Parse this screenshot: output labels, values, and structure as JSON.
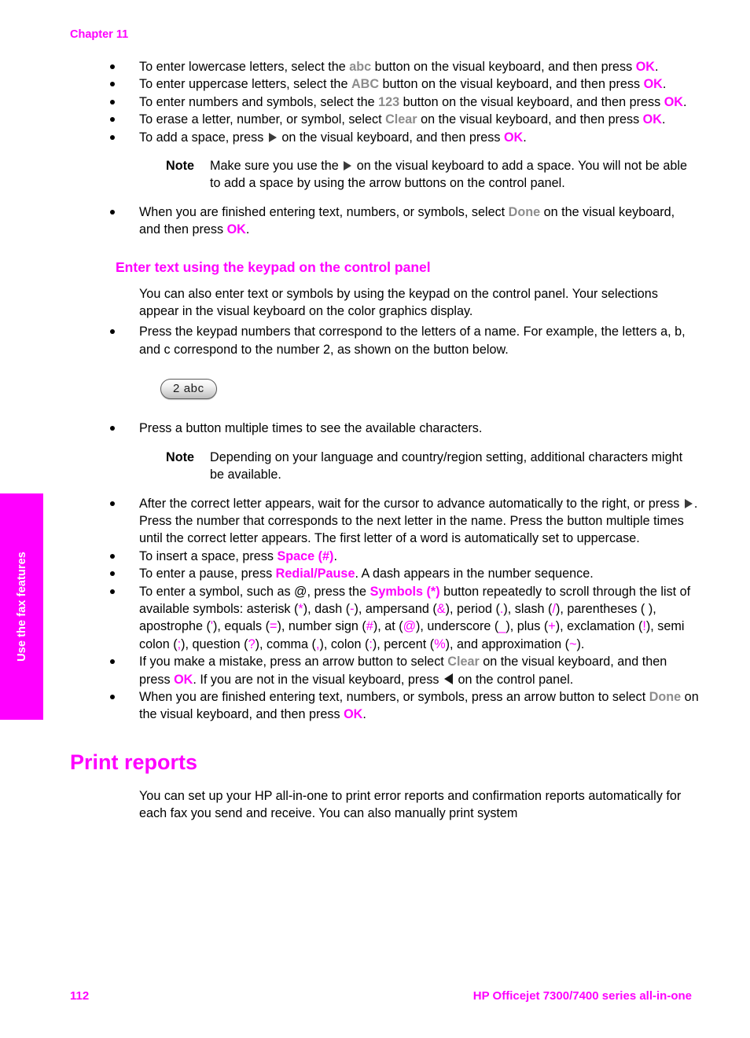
{
  "page": {
    "chapter_label": "Chapter 11",
    "footer_page_number": "112",
    "footer_title": "HP Officejet 7300/7400 series all-in-one",
    "side_tab_label": "Use the fax features",
    "accent_color": "#ff00ff",
    "gray_emphasis_color": "#8c8c8c",
    "text_color": "#000000"
  },
  "visual_keyboard_bullets": {
    "b1": {
      "t1": "To enter lowercase letters, select the ",
      "key": "abc",
      "t2": " button on the visual keyboard, and then press ",
      "ok": "OK",
      "t3": "."
    },
    "b2": {
      "t1": "To enter uppercase letters, select the ",
      "key": "ABC",
      "t2": " button on the visual keyboard, and then press ",
      "ok": "OK",
      "t3": "."
    },
    "b3": {
      "t1": "To enter numbers and symbols, select the ",
      "key": "123",
      "t2": " button on the visual keyboard, and then press ",
      "ok": "OK",
      "t3": "."
    },
    "b4": {
      "t1": "To erase a letter, number, or symbol, select ",
      "key": "Clear",
      "t2": " on the visual keyboard, and then press ",
      "ok": "OK",
      "t3": "."
    },
    "b5": {
      "t1": "To add a space, press ",
      "t2": " on the visual keyboard, and then press ",
      "ok": "OK",
      "t3": "."
    },
    "note1": {
      "label": "Note",
      "t1": "Make sure you use the ",
      "t2": " on the visual keyboard to add a space. You will not be able to add a space by using the arrow buttons on the control panel."
    },
    "b6": {
      "t1": "When you are finished entering text, numbers, or symbols, select ",
      "key": "Done",
      "t2": " on the visual keyboard, and then press ",
      "ok": "OK",
      "t3": "."
    }
  },
  "keypad_section": {
    "heading": "Enter text using the keypad on the control panel",
    "intro": "You can also enter text or symbols by using the keypad on the control panel. Your selections appear in the visual keyboard on the color graphics display.",
    "b1": "Press the keypad numbers that correspond to the letters of a name. For example, the letters a, b, and c correspond to the number 2, as shown on the button below.",
    "keypad_button_label": "2 abc",
    "b2": "Press a button multiple times to see the available characters.",
    "note2": {
      "label": "Note",
      "text": "Depending on your language and country/region setting, additional characters might be available."
    },
    "b3": {
      "t1": "After the correct letter appears, wait for the cursor to advance automatically to the right, or press ",
      "t2": ". Press the number that corresponds to the next letter in the name. Press the button multiple times until the correct letter appears. The first letter of a word is automatically set to uppercase."
    },
    "b4": {
      "t1": "To insert a space, press ",
      "key": "Space (#)",
      "t2": "."
    },
    "b5": {
      "t1": "To enter a pause, press ",
      "key": "Redial/Pause",
      "t2": ". A dash appears in the number sequence."
    },
    "b6": {
      "t1": "To enter a symbol, such as @, press the ",
      "key": "Symbols (*)",
      "t2": " button repeatedly to scroll through the list of available symbols: asterisk (",
      "s1": "*",
      "t3": "), dash (",
      "s2": "-",
      "t4": "), ampersand (",
      "s3": "&",
      "t5": "), period (",
      "s4": ".",
      "t6": "), slash (",
      "s5": "/",
      "t7": "), parentheses (",
      "s6": " ",
      "t8": "), apostrophe (",
      "s7": "'",
      "t9": "), equals (",
      "s8": "=",
      "t10": "), number sign (",
      "s9": "#",
      "t11": "), at (",
      "s10": "@",
      "t12": "), underscore (",
      "s11": "_",
      "t13": "), plus (",
      "s12": "+",
      "t14": "), exclamation (",
      "s13": "!",
      "t15": "), semi colon (",
      "s14": ";",
      "t16": "), question (",
      "s15": "?",
      "t17": "), comma (",
      "s16": ",",
      "t18": "), colon (",
      "s17": ":",
      "t19": "), percent (",
      "s18": "%",
      "t20": "), and approximation (",
      "s19": "~",
      "t21": ")."
    },
    "b7": {
      "t1": "If you make a mistake, press an arrow button to select ",
      "key": "Clear",
      "t2": " on the visual keyboard, and then press ",
      "ok": "OK",
      "t3": ". If you are not in the visual keyboard, press ",
      "t4": " on the control panel."
    },
    "b8": {
      "t1": "When you are finished entering text, numbers, or symbols, press an arrow button to select ",
      "key": "Done",
      "t2": " on the visual keyboard, and then press ",
      "ok": "OK",
      "t3": "."
    }
  },
  "print_reports": {
    "heading": "Print reports",
    "paragraph": "You can set up your HP all-in-one to print error reports and confirmation reports automatically for each fax you send and receive. You can also manually print system"
  }
}
